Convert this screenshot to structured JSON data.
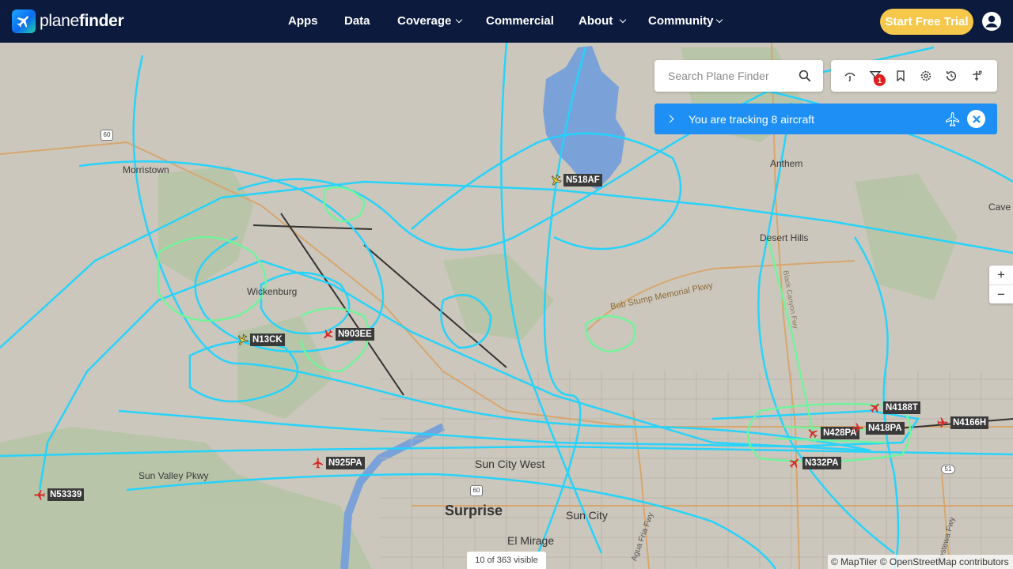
{
  "brand": {
    "name_light": "plane",
    "name_bold": "finder"
  },
  "nav": {
    "apps": "Apps",
    "data": "Data",
    "coverage": "Coverage",
    "commercial": "Commercial",
    "about": "About",
    "community": "Community",
    "trial": "Start Free Trial"
  },
  "search": {
    "placeholder": "Search Plane Finder",
    "value": ""
  },
  "toolbar": {
    "icons": [
      "weather-icon",
      "filter-icon",
      "bookmark-icon",
      "settings-icon",
      "history-icon",
      "airport-icon"
    ],
    "filter_badge": "1"
  },
  "tracking": {
    "text": "You are tracking 8 aircraft"
  },
  "zoom": {
    "in": "+",
    "out": "−"
  },
  "status": {
    "visible": "10 of 363 visible"
  },
  "attribution": "© MapTiler © OpenStreetMap contributors",
  "colors": {
    "navbar": "#0b1a3d",
    "trial_button": "#f5c84c",
    "tracking_banner": "#1e90f5",
    "track_cyan": "#1fd4ff",
    "track_green": "#6ff59a",
    "aircraft_red": "#d62b2b",
    "aircraft_yellow": "#e8d23a",
    "map_background": "#ccc7bc",
    "water": "#7aa2d8"
  },
  "places": {
    "morristown": "Morristown",
    "wickenburg": "Wickenburg",
    "anthem": "Anthem",
    "desert_hills": "Desert Hills",
    "cave_creek": "Cave C",
    "sun_valley": "Sun Valley Pkwy",
    "sun_city_west": "Sun City West",
    "surprise": "Surprise",
    "sun_city": "Sun City",
    "el_mirage": "El Mirage",
    "route60a": "60",
    "route60b": "60",
    "route51": "51",
    "road_memorial": "Bob Stump Memorial Pkwy",
    "agua_fria": "Agua Fria Fwy",
    "piestewa": "Piestewa Fwy",
    "i17": "Black Canyon Fwy"
  },
  "aircraft": [
    {
      "reg": "N518AF",
      "type": "yellow"
    },
    {
      "reg": "N13CK",
      "type": "yellow"
    },
    {
      "reg": "N903EE",
      "type": "red"
    },
    {
      "reg": "N925PA",
      "type": "red"
    },
    {
      "reg": "N53339",
      "type": "red"
    },
    {
      "reg": "N4188T",
      "type": "red"
    },
    {
      "reg": "N4166H",
      "type": "red"
    },
    {
      "reg": "N428PA",
      "type": "red"
    },
    {
      "reg": "N418PA",
      "type": "red"
    },
    {
      "reg": "N332PA",
      "type": "red"
    }
  ]
}
